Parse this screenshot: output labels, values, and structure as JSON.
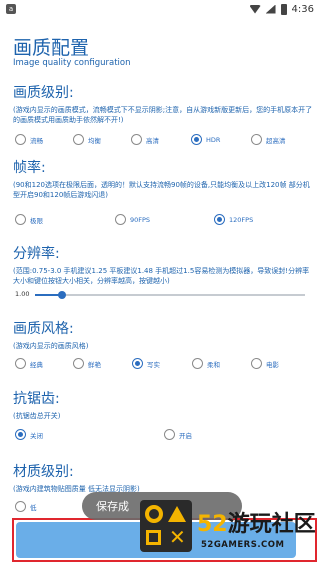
{
  "status_bar": {
    "time": "4:36",
    "notification_badge": "a"
  },
  "header": {
    "title": "画质配置",
    "subtitle": "Image quality configuration"
  },
  "sections": {
    "quality": {
      "title": "画质级别:",
      "desc": "(游戏内显示的画质模式，流畅模式下不显示阴影;注意，自从游戏新版更新后，您的手机原本开了的画质模式用画质助手依然解不开!)",
      "options": [
        "流畅",
        "均衡",
        "高清",
        "HDR",
        "超高清"
      ],
      "selected": "HDR"
    },
    "fps": {
      "title": "帧率:",
      "desc": "(90和120选项在极限后面，透明的！默认支持流畅90帧的设备,只能均衡及以上改120帧 部分机型开启90和120帧后游戏闪退)",
      "options": [
        "极限",
        "90FPS",
        "120FPS"
      ],
      "selected": "120FPS"
    },
    "resolution": {
      "title": "分辨率:",
      "desc": "(范围:0.75-3.0 手机建议1.25 平板建议1.48 手机超过1.5容易检测为模拟器，导致误封!分辨率大小和键位按钮大小相关，分辨率越高，按键越小)",
      "value": "1.00",
      "range": [
        0.75,
        3.0
      ],
      "fill_fraction": 0.1
    },
    "style": {
      "title": "画质风格:",
      "desc": "(游戏内显示的画质风格)",
      "options": [
        "经典",
        "鲜艳",
        "写实",
        "柔和",
        "电影"
      ],
      "selected": "写实"
    },
    "aa": {
      "title": "抗锯齿:",
      "desc": "(抗锯齿总开关)",
      "options": [
        "关闭",
        "开启"
      ],
      "selected": "关闭"
    },
    "material": {
      "title": "材质级别:",
      "desc": "(游戏内建筑物贴图质量 低无法显示阴影)",
      "options": [
        "低"
      ],
      "selected": ""
    }
  },
  "toast": {
    "text": "保存成"
  },
  "watermark": {
    "name_num": "52",
    "name_text": "游玩社区",
    "domain": "52GAMERS.COM"
  },
  "colors": {
    "accent": "#2b6dbf",
    "title": "#1e63ad",
    "save_button": "#6aaee8",
    "highlight_border": "#e0262e"
  }
}
